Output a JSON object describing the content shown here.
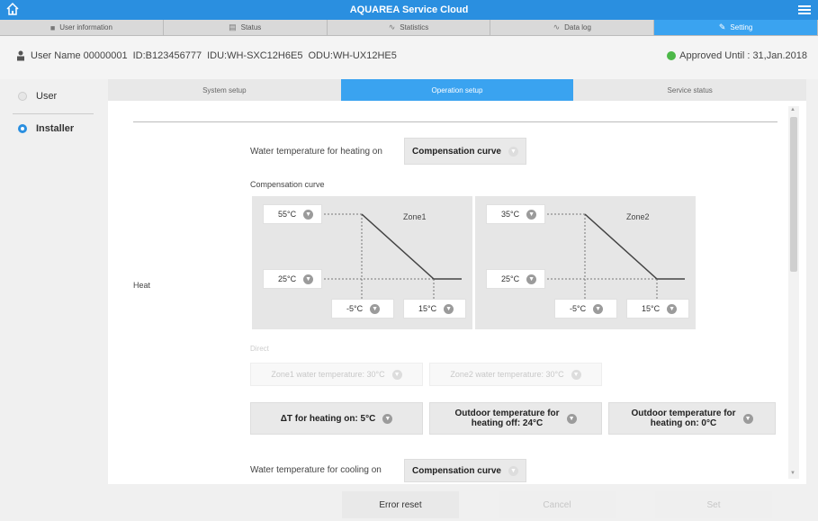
{
  "app": {
    "title": "AQUAREA Service Cloud"
  },
  "nav_tabs": [
    {
      "label": "User information",
      "icon": "person-icon"
    },
    {
      "label": "Status",
      "icon": "status-icon"
    },
    {
      "label": "Statistics",
      "icon": "statistics-icon"
    },
    {
      "label": "Data log",
      "icon": "data-log-icon"
    },
    {
      "label": "Setting",
      "icon": "setting-icon"
    }
  ],
  "info": {
    "user_name": "User Name 00000001",
    "id": "ID:B123456777",
    "idu": "IDU:WH-SXC12H6E5",
    "odu": "ODU:WH-UX12HE5",
    "approved": "Approved Until : 31,Jan.2018"
  },
  "sidebar": {
    "items": [
      {
        "label": "User"
      },
      {
        "label": "Installer"
      }
    ]
  },
  "sub_tabs": [
    "System setup",
    "Operation setup",
    "Service status"
  ],
  "heat": {
    "section_label": "Heat",
    "water_heating_on_label": "Water temperature for heating on",
    "water_heating_on_value": "Compensation curve",
    "compensation_curve_label": "Compensation curve",
    "zone1": {
      "name": "Zone1",
      "top": "55°C",
      "bottom": "25°C",
      "x1": "-5°C",
      "x2": "15°C"
    },
    "zone2": {
      "name": "Zone2",
      "top": "35°C",
      "bottom": "25°C",
      "x1": "-5°C",
      "x2": "15°C"
    },
    "direct_label": "Direct",
    "zone1_direct": "Zone1 water temperature: 30°C",
    "zone2_direct": "Zone2 water temperature: 30°C",
    "delta_heating": "ΔT for heating on: 5°C",
    "outdoor_off_line1": "Outdoor temperature for",
    "outdoor_off_line2": "heating off: 24°C",
    "outdoor_on_line1": "Outdoor temperature for",
    "outdoor_on_line2": "heating on: 0°C",
    "water_cooling_on_label": "Water temperature for cooling on",
    "water_cooling_on_value": "Compensation curve"
  },
  "footer": {
    "error_reset": "Error reset",
    "cancel": "Cancel",
    "set": "Set"
  },
  "colors": {
    "accent": "#3aa3f0",
    "approved_dot": "#4cb848"
  }
}
